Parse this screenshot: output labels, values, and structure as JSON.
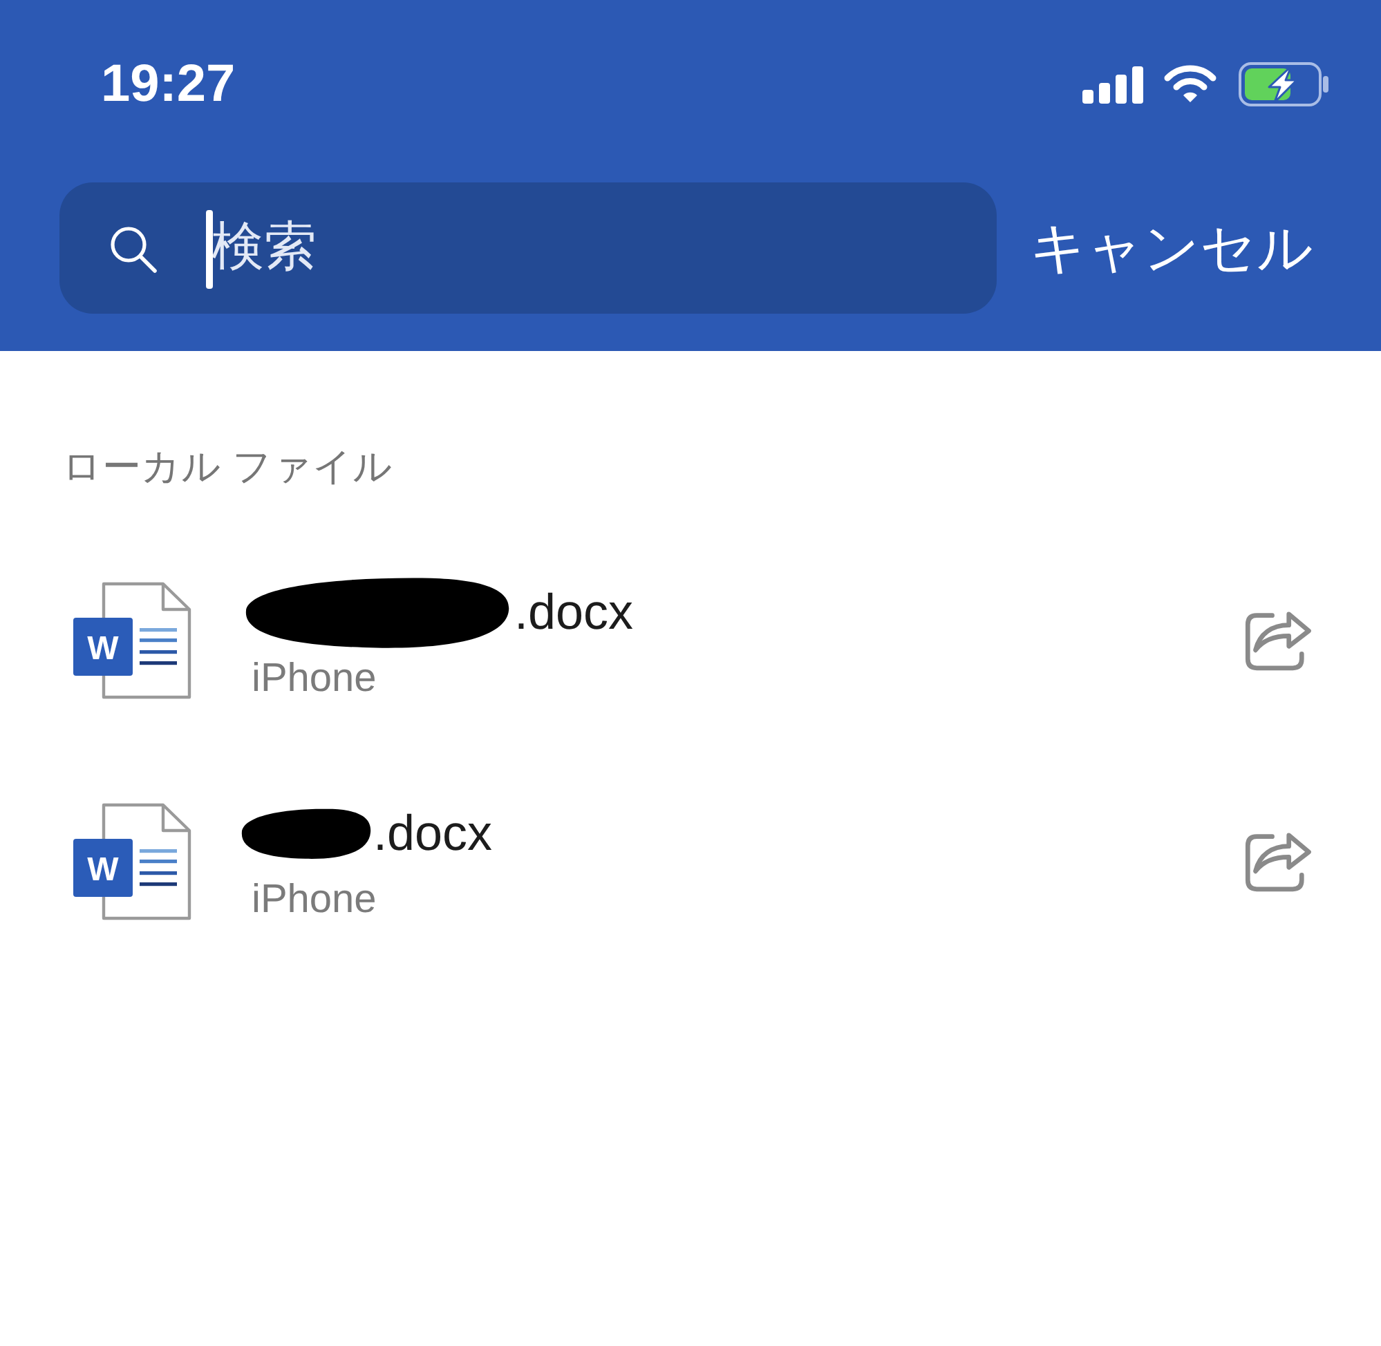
{
  "status_bar": {
    "time": "19:27"
  },
  "search": {
    "placeholder": "検索",
    "focused": true,
    "cancel": "キャンセル"
  },
  "section": {
    "title": "ローカル ファイル"
  },
  "files": [
    {
      "icon_letter": "W",
      "redacted": true,
      "name": ".docx",
      "location": "iPhone"
    },
    {
      "icon_letter": "W",
      "redacted": true,
      "name": ".docx",
      "location": "iPhone"
    }
  ]
}
